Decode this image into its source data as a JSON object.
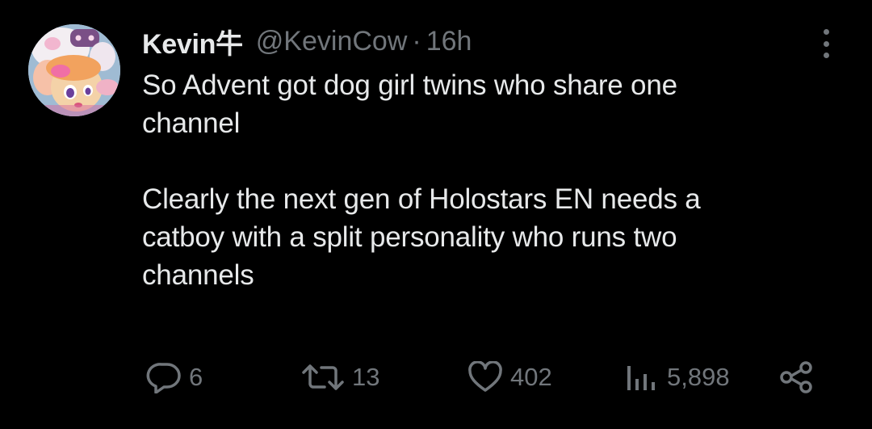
{
  "tweet": {
    "display_name": "Kevin牛",
    "handle": "@KevinCow",
    "separator": "·",
    "timestamp": "16h",
    "text": "So Advent got dog girl twins who share one\nchannel\n\nClearly the next gen of Holostars EN needs a\ncatboy with a split personality who runs two\nchannels",
    "avatar_icon": "anime-cow-avatar"
  },
  "actions": {
    "replies": "6",
    "retweets": "13",
    "likes": "402",
    "views": "5,898"
  },
  "icons": {
    "more": "more-vertical-icon",
    "reply": "reply-bubble-icon",
    "retweet": "retweet-arrows-icon",
    "like": "heart-icon",
    "views": "bar-chart-icon",
    "share": "share-nodes-icon"
  },
  "colors": {
    "background": "#000000",
    "primary_text": "#e7e9ea",
    "secondary_text": "#71767b"
  }
}
